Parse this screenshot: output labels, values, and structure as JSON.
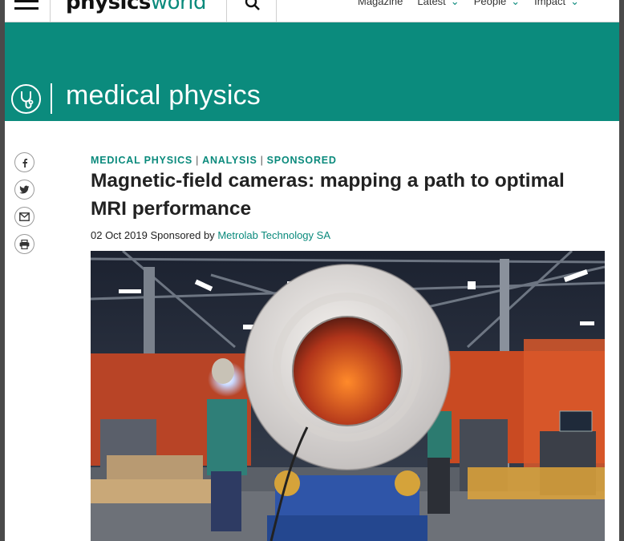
{
  "header": {
    "logo_main": "physics",
    "logo_accent": "world",
    "nav": [
      {
        "label": "Magazine"
      },
      {
        "label": "Latest"
      },
      {
        "label": "People"
      },
      {
        "label": "Impact"
      }
    ]
  },
  "banner": {
    "section_title": "medical physics",
    "icon": "stethoscope-icon"
  },
  "share": {
    "icons": [
      "facebook-icon",
      "twitter-icon",
      "email-icon",
      "print-icon"
    ]
  },
  "article": {
    "kicker": [
      "MEDICAL PHYSICS",
      "ANALYSIS",
      "SPONSORED"
    ],
    "kicker_sep": "|",
    "title": "Magnetic-field cameras: mapping a path to optimal MRI performance",
    "date": "02 Oct 2019",
    "sponsored_by": "Sponsored by",
    "sponsor": "Metrolab Technology SA"
  },
  "colors": {
    "brand_teal": "#0b8b7d",
    "text_dark": "#222222"
  }
}
